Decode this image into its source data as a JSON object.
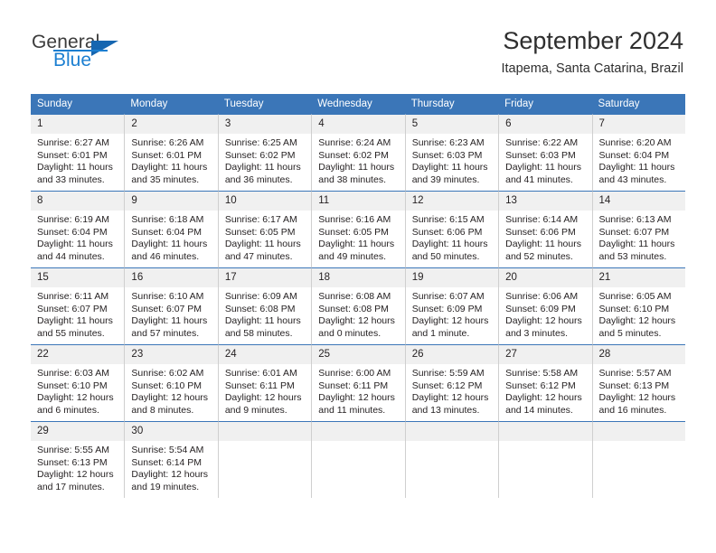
{
  "brand": {
    "name_part1": "General",
    "name_part2": "Blue",
    "triangle_icon": "triangle-icon",
    "accent_blue": "#1c7fd1",
    "logo_dark": "#3b3b3b"
  },
  "header": {
    "title": "September 2024",
    "location": "Itapema, Santa Catarina, Brazil"
  },
  "theme": {
    "header_row_bg": "#3b76b8",
    "header_row_text": "#ffffff",
    "daynum_bg": "#f0f0f0",
    "cell_border": "#cfcfcf",
    "row_top_border": "#3b76b8",
    "body_text": "#231f20"
  },
  "calendar": {
    "weekday_headers": [
      "Sunday",
      "Monday",
      "Tuesday",
      "Wednesday",
      "Thursday",
      "Friday",
      "Saturday"
    ],
    "weeks": [
      [
        {
          "day": "1",
          "sunrise": "Sunrise: 6:27 AM",
          "sunset": "Sunset: 6:01 PM",
          "daylight": "Daylight: 11 hours and 33 minutes."
        },
        {
          "day": "2",
          "sunrise": "Sunrise: 6:26 AM",
          "sunset": "Sunset: 6:01 PM",
          "daylight": "Daylight: 11 hours and 35 minutes."
        },
        {
          "day": "3",
          "sunrise": "Sunrise: 6:25 AM",
          "sunset": "Sunset: 6:02 PM",
          "daylight": "Daylight: 11 hours and 36 minutes."
        },
        {
          "day": "4",
          "sunrise": "Sunrise: 6:24 AM",
          "sunset": "Sunset: 6:02 PM",
          "daylight": "Daylight: 11 hours and 38 minutes."
        },
        {
          "day": "5",
          "sunrise": "Sunrise: 6:23 AM",
          "sunset": "Sunset: 6:03 PM",
          "daylight": "Daylight: 11 hours and 39 minutes."
        },
        {
          "day": "6",
          "sunrise": "Sunrise: 6:22 AM",
          "sunset": "Sunset: 6:03 PM",
          "daylight": "Daylight: 11 hours and 41 minutes."
        },
        {
          "day": "7",
          "sunrise": "Sunrise: 6:20 AM",
          "sunset": "Sunset: 6:04 PM",
          "daylight": "Daylight: 11 hours and 43 minutes."
        }
      ],
      [
        {
          "day": "8",
          "sunrise": "Sunrise: 6:19 AM",
          "sunset": "Sunset: 6:04 PM",
          "daylight": "Daylight: 11 hours and 44 minutes."
        },
        {
          "day": "9",
          "sunrise": "Sunrise: 6:18 AM",
          "sunset": "Sunset: 6:04 PM",
          "daylight": "Daylight: 11 hours and 46 minutes."
        },
        {
          "day": "10",
          "sunrise": "Sunrise: 6:17 AM",
          "sunset": "Sunset: 6:05 PM",
          "daylight": "Daylight: 11 hours and 47 minutes."
        },
        {
          "day": "11",
          "sunrise": "Sunrise: 6:16 AM",
          "sunset": "Sunset: 6:05 PM",
          "daylight": "Daylight: 11 hours and 49 minutes."
        },
        {
          "day": "12",
          "sunrise": "Sunrise: 6:15 AM",
          "sunset": "Sunset: 6:06 PM",
          "daylight": "Daylight: 11 hours and 50 minutes."
        },
        {
          "day": "13",
          "sunrise": "Sunrise: 6:14 AM",
          "sunset": "Sunset: 6:06 PM",
          "daylight": "Daylight: 11 hours and 52 minutes."
        },
        {
          "day": "14",
          "sunrise": "Sunrise: 6:13 AM",
          "sunset": "Sunset: 6:07 PM",
          "daylight": "Daylight: 11 hours and 53 minutes."
        }
      ],
      [
        {
          "day": "15",
          "sunrise": "Sunrise: 6:11 AM",
          "sunset": "Sunset: 6:07 PM",
          "daylight": "Daylight: 11 hours and 55 minutes."
        },
        {
          "day": "16",
          "sunrise": "Sunrise: 6:10 AM",
          "sunset": "Sunset: 6:07 PM",
          "daylight": "Daylight: 11 hours and 57 minutes."
        },
        {
          "day": "17",
          "sunrise": "Sunrise: 6:09 AM",
          "sunset": "Sunset: 6:08 PM",
          "daylight": "Daylight: 11 hours and 58 minutes."
        },
        {
          "day": "18",
          "sunrise": "Sunrise: 6:08 AM",
          "sunset": "Sunset: 6:08 PM",
          "daylight": "Daylight: 12 hours and 0 minutes."
        },
        {
          "day": "19",
          "sunrise": "Sunrise: 6:07 AM",
          "sunset": "Sunset: 6:09 PM",
          "daylight": "Daylight: 12 hours and 1 minute."
        },
        {
          "day": "20",
          "sunrise": "Sunrise: 6:06 AM",
          "sunset": "Sunset: 6:09 PM",
          "daylight": "Daylight: 12 hours and 3 minutes."
        },
        {
          "day": "21",
          "sunrise": "Sunrise: 6:05 AM",
          "sunset": "Sunset: 6:10 PM",
          "daylight": "Daylight: 12 hours and 5 minutes."
        }
      ],
      [
        {
          "day": "22",
          "sunrise": "Sunrise: 6:03 AM",
          "sunset": "Sunset: 6:10 PM",
          "daylight": "Daylight: 12 hours and 6 minutes."
        },
        {
          "day": "23",
          "sunrise": "Sunrise: 6:02 AM",
          "sunset": "Sunset: 6:10 PM",
          "daylight": "Daylight: 12 hours and 8 minutes."
        },
        {
          "day": "24",
          "sunrise": "Sunrise: 6:01 AM",
          "sunset": "Sunset: 6:11 PM",
          "daylight": "Daylight: 12 hours and 9 minutes."
        },
        {
          "day": "25",
          "sunrise": "Sunrise: 6:00 AM",
          "sunset": "Sunset: 6:11 PM",
          "daylight": "Daylight: 12 hours and 11 minutes."
        },
        {
          "day": "26",
          "sunrise": "Sunrise: 5:59 AM",
          "sunset": "Sunset: 6:12 PM",
          "daylight": "Daylight: 12 hours and 13 minutes."
        },
        {
          "day": "27",
          "sunrise": "Sunrise: 5:58 AM",
          "sunset": "Sunset: 6:12 PM",
          "daylight": "Daylight: 12 hours and 14 minutes."
        },
        {
          "day": "28",
          "sunrise": "Sunrise: 5:57 AM",
          "sunset": "Sunset: 6:13 PM",
          "daylight": "Daylight: 12 hours and 16 minutes."
        }
      ],
      [
        {
          "day": "29",
          "sunrise": "Sunrise: 5:55 AM",
          "sunset": "Sunset: 6:13 PM",
          "daylight": "Daylight: 12 hours and 17 minutes."
        },
        {
          "day": "30",
          "sunrise": "Sunrise: 5:54 AM",
          "sunset": "Sunset: 6:14 PM",
          "daylight": "Daylight: 12 hours and 19 minutes."
        },
        {
          "day": "",
          "sunrise": "",
          "sunset": "",
          "daylight": ""
        },
        {
          "day": "",
          "sunrise": "",
          "sunset": "",
          "daylight": ""
        },
        {
          "day": "",
          "sunrise": "",
          "sunset": "",
          "daylight": ""
        },
        {
          "day": "",
          "sunrise": "",
          "sunset": "",
          "daylight": ""
        },
        {
          "day": "",
          "sunrise": "",
          "sunset": "",
          "daylight": ""
        }
      ]
    ]
  }
}
